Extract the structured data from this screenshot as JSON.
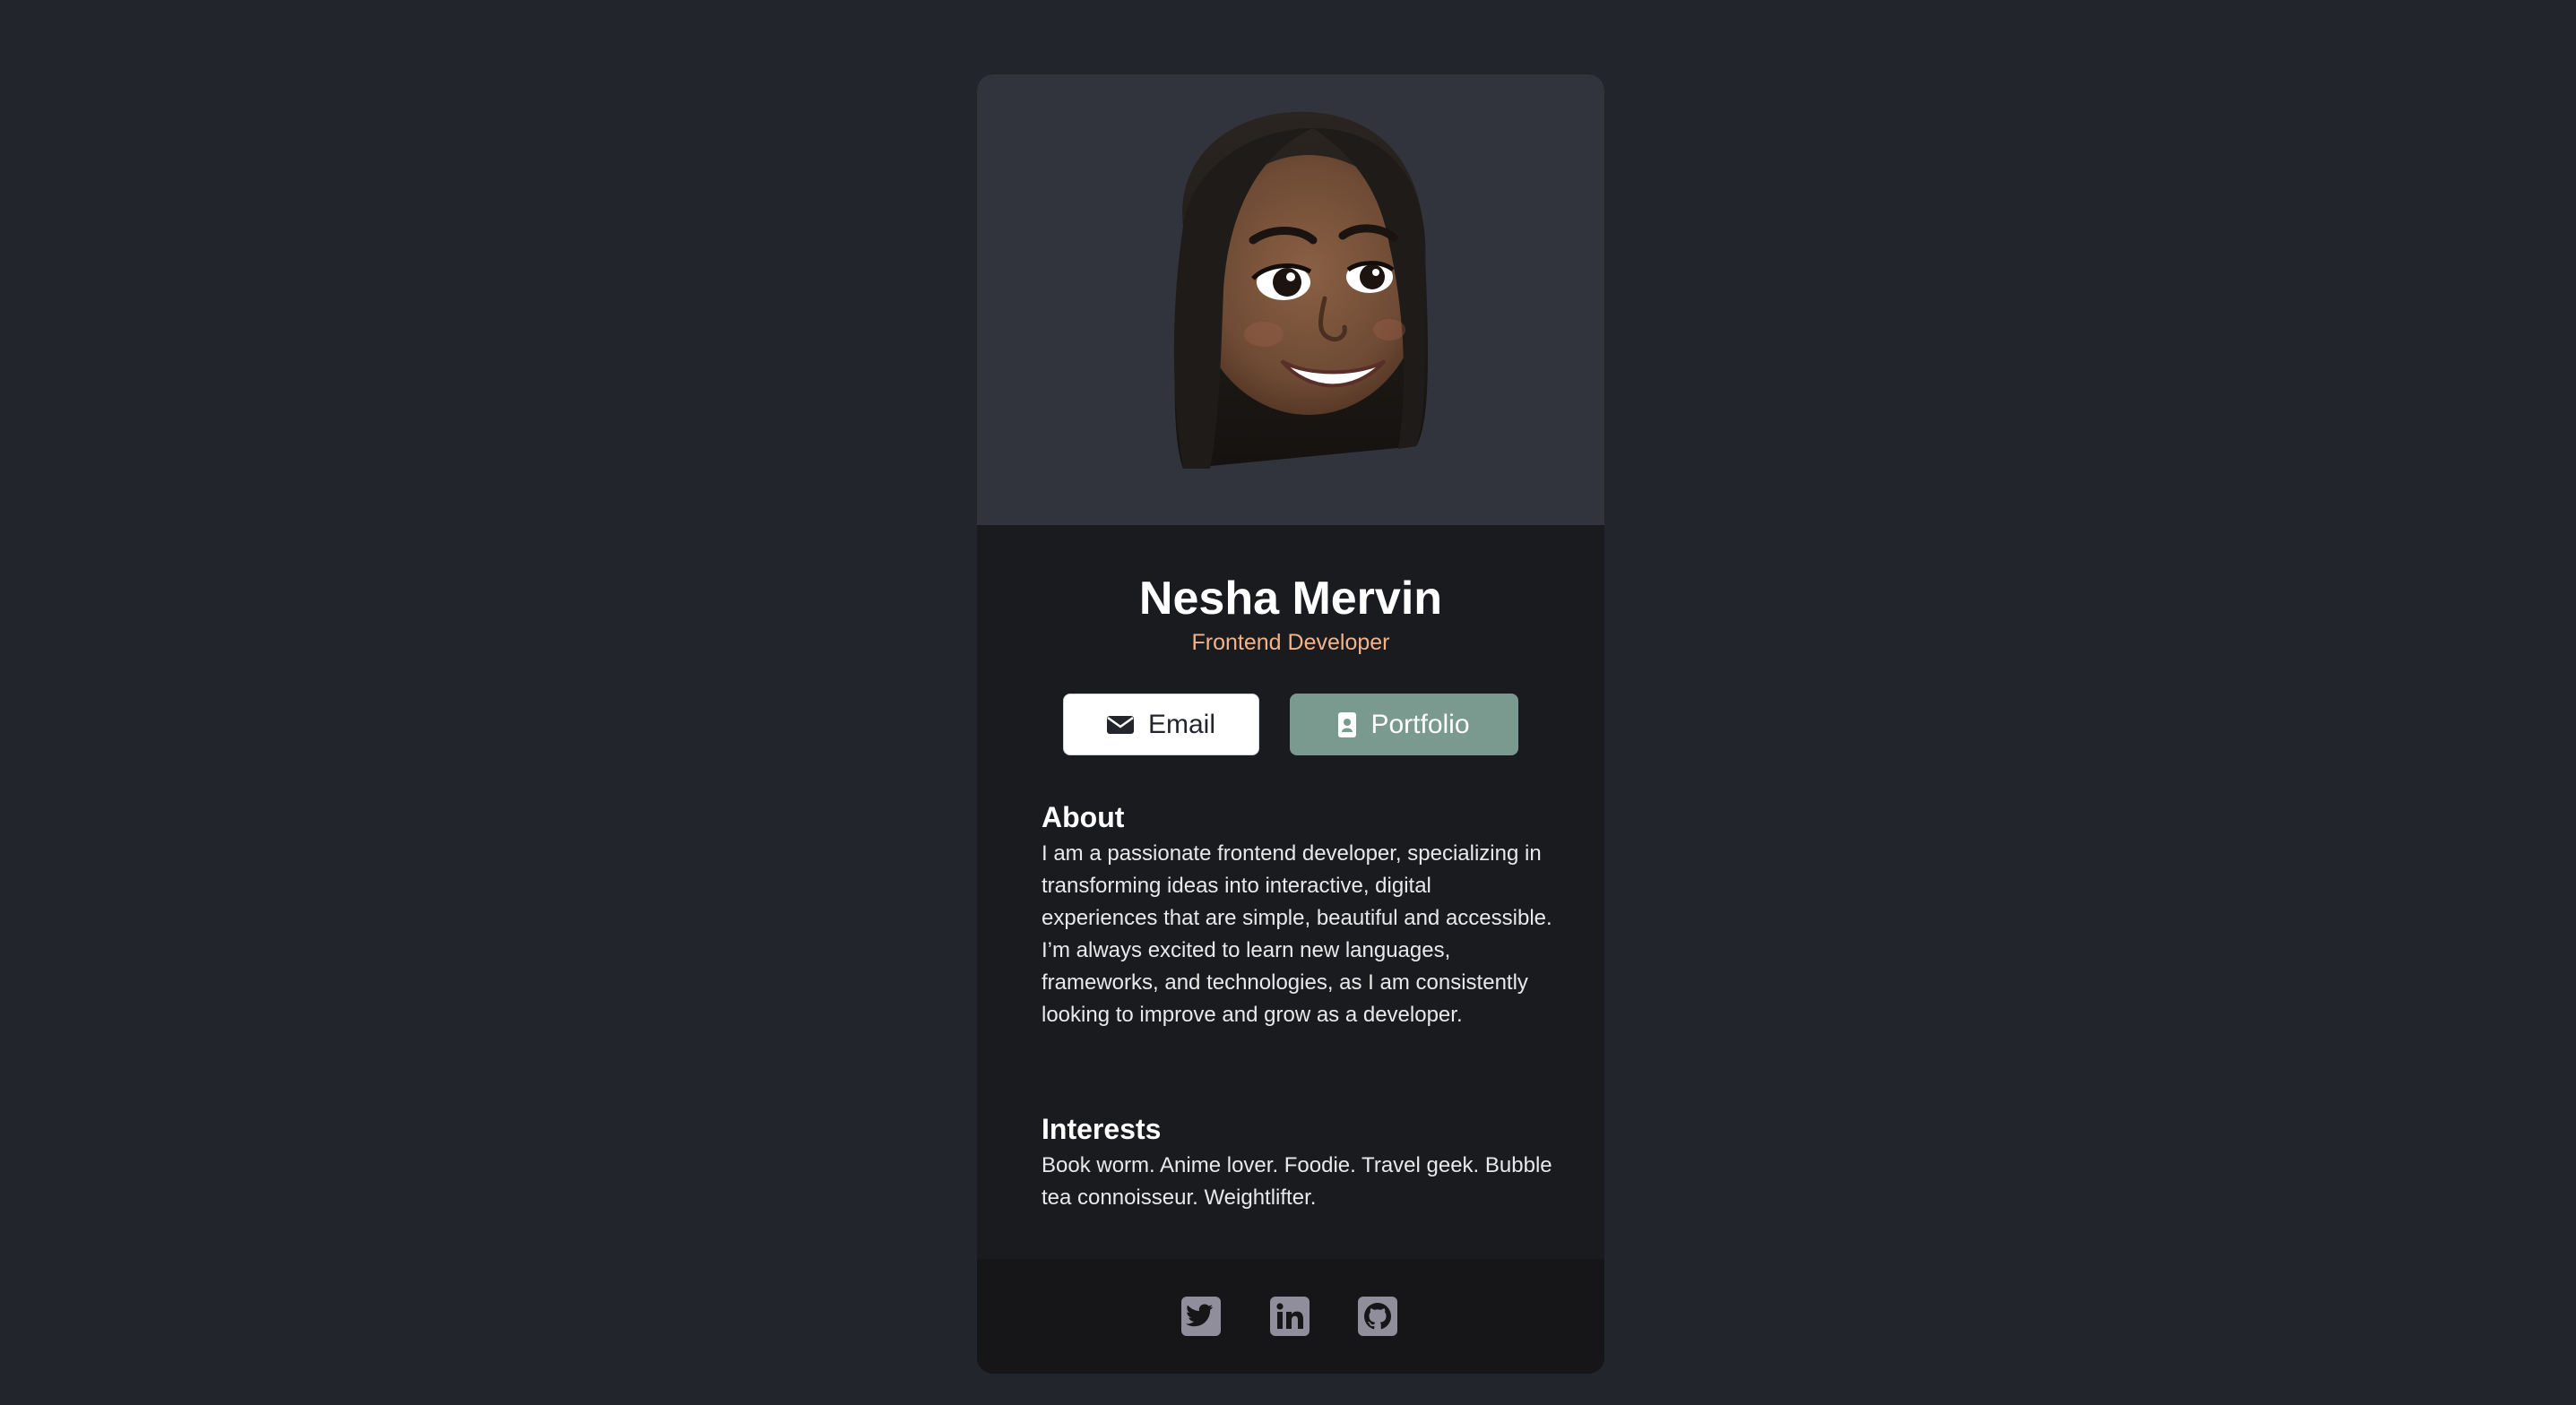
{
  "profile": {
    "name": "Nesha Mervin",
    "role": "Frontend Developer"
  },
  "buttons": {
    "email_label": "Email",
    "portfolio_label": "Portfolio",
    "email_icon": "envelope-icon",
    "portfolio_icon": "id-badge-icon"
  },
  "about": {
    "heading": "About",
    "text": "I am a passionate frontend developer, specializing in transforming ideas into interactive, digital experiences that are simple, beautiful and accessible. I’m always excited to learn new languages, frameworks, and technologies, as I am consistently looking to improve and grow as a developer."
  },
  "interests": {
    "heading": "Interests",
    "text": "Book worm. Anime lover. Foodie. Travel geek. Bubble tea connoisseur. Weightlifter."
  },
  "social": [
    "twitter-icon",
    "linkedin-icon",
    "github-icon"
  ],
  "colors": {
    "page_bg": "#23252c",
    "card_bg": "#1a1b1f",
    "photo_bg": "#31343c",
    "footer_bg": "#161619",
    "accent": "#f4b48a",
    "portfolio_button": "#7a9a8f",
    "social_icon": "#918e9b"
  }
}
